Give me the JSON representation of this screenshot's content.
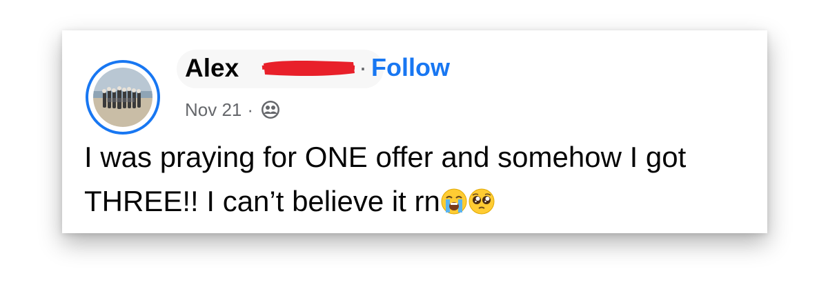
{
  "post": {
    "author": "Alex",
    "follow_separator": "·",
    "follow_label": "Follow",
    "date": "Nov 21",
    "meta_separator": "·",
    "audience_icon": "friends-icon",
    "text_line1": "I was praying for ONE offer and somehow I got",
    "text_line2": "THREE!!  I can’t believe it rn",
    "emojis": [
      "loudly-crying-face",
      "pleading-face"
    ]
  },
  "colors": {
    "link_blue": "#1877f2",
    "meta_gray": "#65676b",
    "redaction_red": "#e8202a"
  }
}
